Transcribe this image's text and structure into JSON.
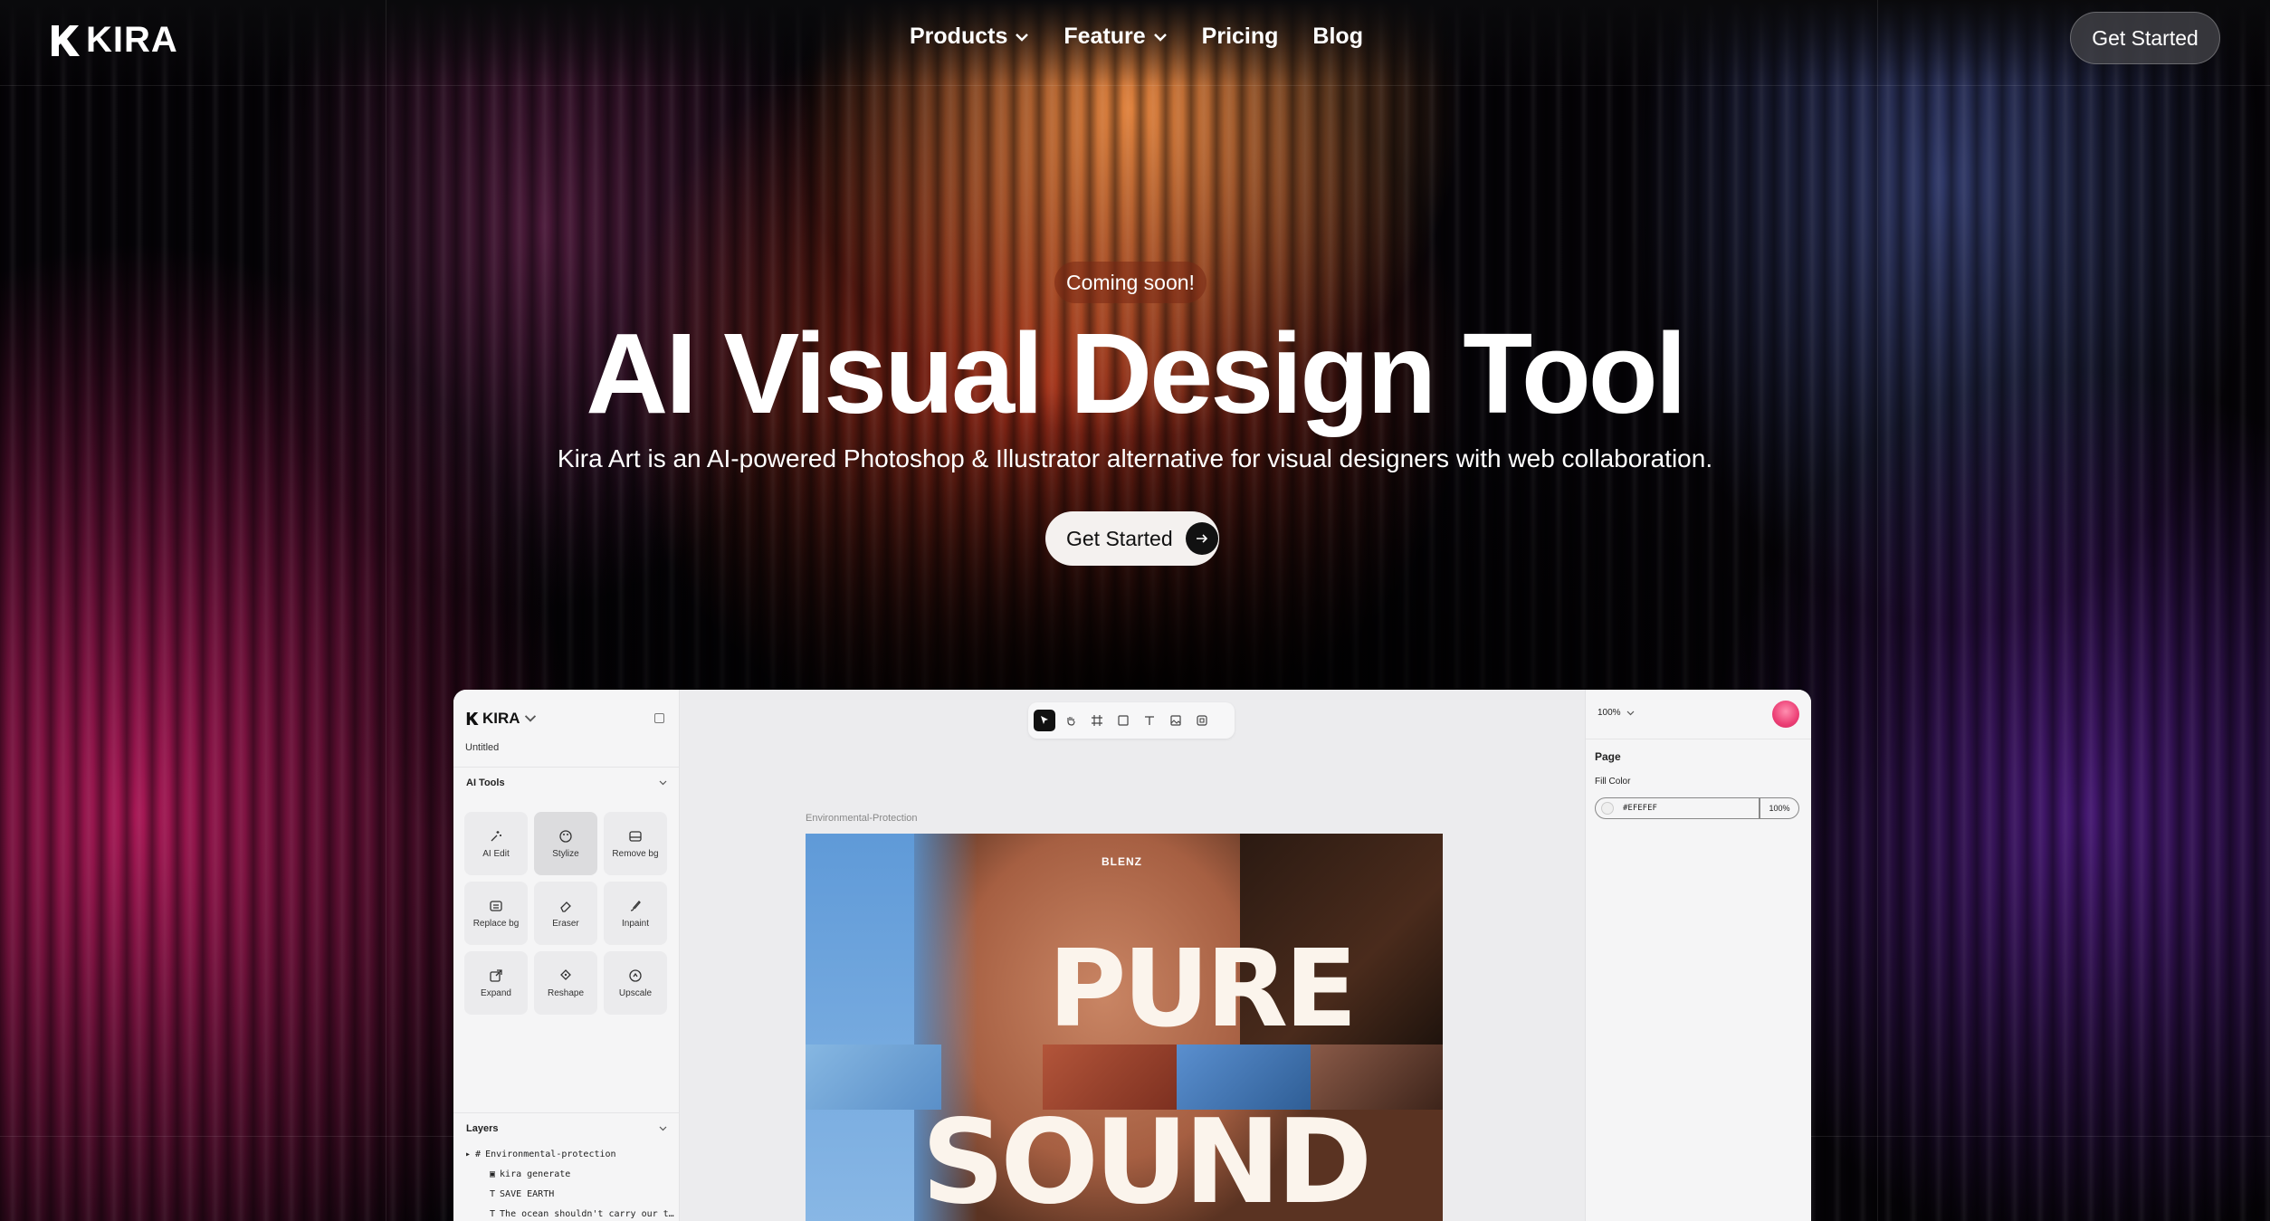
{
  "brand": {
    "name": "KIRA"
  },
  "nav": {
    "links": [
      {
        "label": "Products",
        "has_dropdown": true
      },
      {
        "label": "Feature",
        "has_dropdown": true
      },
      {
        "label": "Pricing",
        "has_dropdown": false
      },
      {
        "label": "Blog",
        "has_dropdown": false
      }
    ],
    "cta": "Get Started"
  },
  "hero": {
    "badge": "Coming soon!",
    "title": "AI Visual Design Tool",
    "subtitle": "Kira Art is an AI-powered Photoshop & Illustrator alternative for visual designers with web collaboration.",
    "cta": "Get Started"
  },
  "app": {
    "logo": "KIRA",
    "document_name": "Untitled",
    "ai_tools_header": "AI Tools",
    "tools": [
      {
        "label": "AI Edit",
        "icon": "sparkle-icon"
      },
      {
        "label": "Stylize",
        "icon": "palette-icon",
        "active": true
      },
      {
        "label": "Remove bg",
        "icon": "remove-bg-icon"
      },
      {
        "label": "Replace bg",
        "icon": "replace-bg-icon"
      },
      {
        "label": "Eraser",
        "icon": "eraser-icon"
      },
      {
        "label": "Inpaint",
        "icon": "brush-icon"
      },
      {
        "label": "Expand",
        "icon": "expand-icon"
      },
      {
        "label": "Reshape",
        "icon": "reshape-icon"
      },
      {
        "label": "Upscale",
        "icon": "upscale-icon"
      }
    ],
    "layers_header": "Layers",
    "layers": [
      {
        "label": "Environmental-protection",
        "icon": "frame-icon"
      },
      {
        "label": "kira generate",
        "icon": "image-icon"
      },
      {
        "label": "SAVE EARTH",
        "icon": "text-icon"
      },
      {
        "label": "The ocean shouldn't carry our t…",
        "icon": "text-icon"
      }
    ],
    "canvas": {
      "frame_label": "Environmental-Protection",
      "artwork": {
        "brand": "BLENZ",
        "headline_1": "PURE",
        "headline_2": "SOUND"
      }
    },
    "toolbar": [
      "pointer-icon",
      "hand-icon",
      "frame-icon",
      "rectangle-icon",
      "text-icon",
      "image-icon",
      "component-icon"
    ],
    "inspector": {
      "zoom": "100%",
      "section": "Page",
      "fill_label": "Fill Color",
      "fill_value": "#EFEFEF",
      "fill_opacity": "100%"
    }
  },
  "colors": {
    "accent_text": "#ffffff",
    "cta_bg": "#f4f1ef",
    "app_bg": "#ececee"
  }
}
